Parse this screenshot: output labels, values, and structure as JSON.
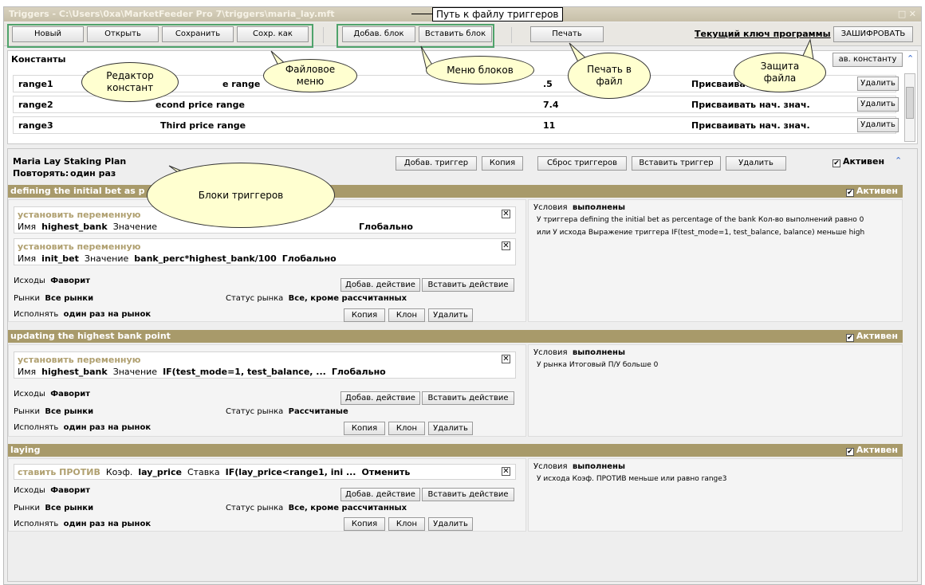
{
  "title": "Triggers - C:\\Users\\0xa\\MarketFeeder Pro 7\\triggers\\maria_lay.mft",
  "window_controls": "□ ✕",
  "toolbar": {
    "new": "Новый",
    "open": "Открыть",
    "save": "Сохранить",
    "save_as": "Сохр. как",
    "add_block": "Добав. блок",
    "insert_block": "Вставить блок",
    "print": "Печать",
    "key_link": "Текущий ключ программы",
    "encrypt": "ЗАШИФРОВАТЬ"
  },
  "constants": {
    "header": "Константы",
    "add_btn": "ав. константу",
    "rows": [
      {
        "name": "range1",
        "desc": "e range",
        "value": ".5",
        "mode": "Присваиват",
        "delete": "Удалить"
      },
      {
        "name": "range2",
        "desc": "econd price range",
        "value": "7.4",
        "mode": "Присваивать нач. знач.",
        "delete": "Удалить"
      },
      {
        "name": "range3",
        "desc": "Third price range",
        "value": "11",
        "mode": "Присваивать нач. знач.",
        "delete": "Удалить"
      }
    ]
  },
  "plan": {
    "name": "Maria Lay Staking Plan",
    "repeat_label": "Повторять:",
    "repeat_value": "один раз",
    "buttons": {
      "add_trigger": "Добав. триггер",
      "copy": "Копия",
      "reset": "Сброс триггеров",
      "insert": "Вставить триггер",
      "delete": "Удалить"
    },
    "active": "Активен"
  },
  "triggers": [
    {
      "title": "defining the initial bet as p",
      "active": "Активен",
      "actions": [
        {
          "type": "установить переменную",
          "line_a": "Имя",
          "line_b": "highest_bank",
          "line_c": "Значение",
          "line_d": "Глобально"
        },
        {
          "type": "установить переменную",
          "line_a": "Имя",
          "line_b": "init_bet",
          "line_c": "Значение",
          "line_d": "bank_perc*highest_bank/100",
          "line_e": "Глобально"
        }
      ],
      "outcomes_label": "Исходы",
      "outcomes": "Фаворит",
      "markets_label": "Рынки",
      "markets": "Все рынки",
      "status_label": "Статус рынка",
      "status": "Все, кроме рассчитанных",
      "exec_label": "Исполнять",
      "exec": "один раз на рынок",
      "cond_label": "Условия",
      "cond_state": "выполнены",
      "cond1": "У триггера defining the initial bet as percentage of the bank Кол-во выполнений равно 0",
      "cond2": "или У исхода Выражение триггера IF(test_mode=1, test_balance, balance) меньше high"
    },
    {
      "title": "updating the highest bank point",
      "active": "Активен",
      "actions": [
        {
          "type": "установить переменную",
          "line_a": "Имя",
          "line_b": "highest_bank",
          "line_c": "Значение",
          "line_d": "IF(test_mode=1, test_balance, ...",
          "line_e": "Глобально"
        }
      ],
      "outcomes_label": "Исходы",
      "outcomes": "Фаворит",
      "markets_label": "Рынки",
      "markets": "Все рынки",
      "status_label": "Статус рынка",
      "status": "Рассчитаные",
      "exec_label": "Исполнять",
      "exec": "один раз на рынок",
      "cond_label": "Условия",
      "cond_state": "выполнены",
      "cond1": "У рынка Итоговый П/У больше 0"
    },
    {
      "title": "laying",
      "active": "Активен",
      "action_line": {
        "a": "ставить ПРОТИВ",
        "b": "Коэф.",
        "c": "lay_price",
        "d": "Ставка",
        "e": "IF(lay_price<range1, ini ...",
        "f": "Отменить"
      },
      "outcomes_label": "Исходы",
      "outcomes": "Фаворит",
      "markets_label": "Рынки",
      "markets": "Все рынки",
      "status_label": "Статус рынка",
      "status": "Все, кроме рассчитанных",
      "exec_label": "Исполнять",
      "exec": "один раз на рынок",
      "cond_label": "Условия",
      "cond_state": "выполнены",
      "cond1": "У исхода Коэф. ПРОТИВ меньше или равно range3"
    }
  ],
  "row_buttons": {
    "add_action": "Добав. действие",
    "insert_action": "Вставить действие",
    "copy": "Копия",
    "clone": "Клон",
    "delete": "Удалить"
  },
  "callouts": {
    "path": "Путь к файлу триггеров",
    "const_editor": "Редактор констант",
    "file_menu": "Файловое меню",
    "block_menu": "Меню блоков",
    "print_file": "Печать в файл",
    "protect": "Защита файла",
    "trigger_blocks": "Блоки триггеров"
  }
}
